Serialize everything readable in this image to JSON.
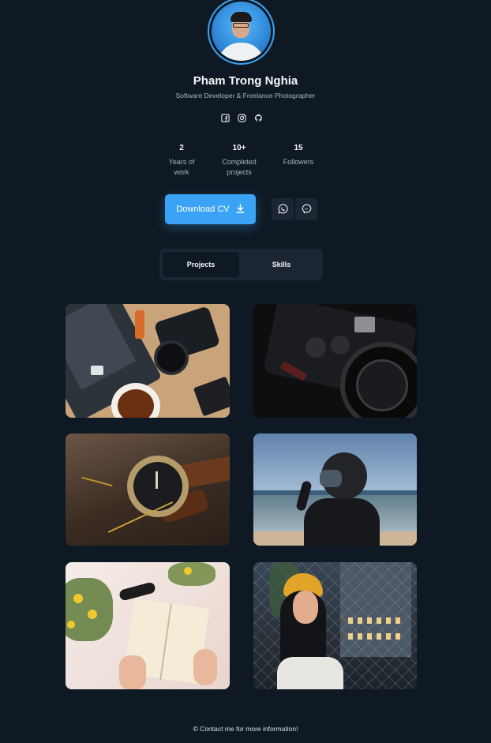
{
  "profile": {
    "name": "Pham Trong Nghia",
    "subtitle": "Software Developer & Freelance Photographer"
  },
  "socials": [
    {
      "icon": "facebook-icon"
    },
    {
      "icon": "instagram-icon"
    },
    {
      "icon": "github-icon"
    }
  ],
  "stats": [
    {
      "value": "2",
      "label_line1": "Years of",
      "label_line2": "work"
    },
    {
      "value": "10+",
      "label_line1": "Completed",
      "label_line2": "projects"
    },
    {
      "value": "15",
      "label_line1": "Followers",
      "label_line2": ""
    }
  ],
  "actions": {
    "download_label": "Download CV",
    "download_icon": "download-icon",
    "whatsapp_icon": "whatsapp-icon",
    "messenger_icon": "messenger-icon"
  },
  "tabs": [
    {
      "label": "Projects",
      "active": true
    },
    {
      "label": "Skills",
      "active": false
    }
  ],
  "gallery": [
    {
      "subject": "laptop, camera and coffee flat lay"
    },
    {
      "subject": "black mirrorless camera on dark background"
    },
    {
      "subject": "wristwatch on wooden table"
    },
    {
      "subject": "person in helmet on beach"
    },
    {
      "subject": "open book with yellow flowers"
    },
    {
      "subject": "woman in yellow hat by fence"
    }
  ],
  "footer": {
    "text": "© Contact me for more information!"
  },
  "colors": {
    "background": "#0f1923",
    "accent": "#3ba3f5",
    "surface": "#1c2633",
    "muted_text": "#aab4c0"
  }
}
